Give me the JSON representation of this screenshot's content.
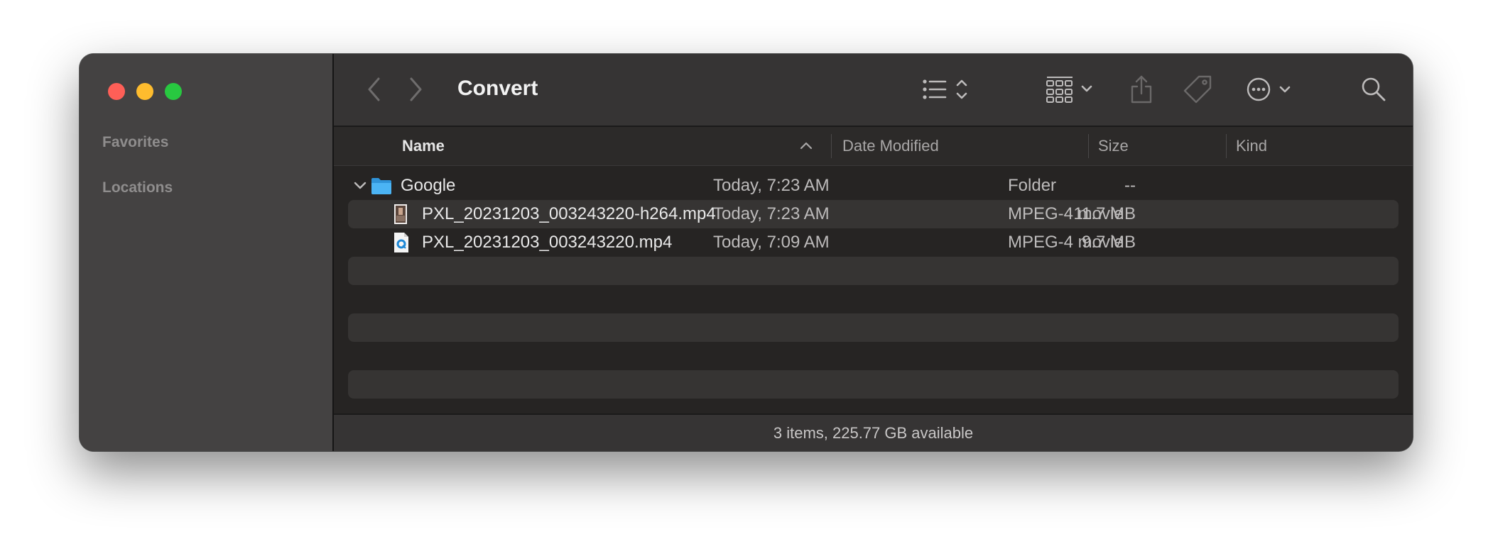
{
  "sidebar": {
    "sections": [
      "Favorites",
      "Locations"
    ]
  },
  "toolbar": {
    "title": "Convert"
  },
  "columns": {
    "name": "Name",
    "date": "Date Modified",
    "size": "Size",
    "kind": "Kind"
  },
  "files": [
    {
      "name": "Google",
      "date": "Today, 7:23 AM",
      "size": "--",
      "kind": "Folder",
      "icon": "folder-icon"
    },
    {
      "name": "PXL_20231203_003243220-h264.mp4",
      "date": "Today, 7:23 AM",
      "size": "11.7 MB",
      "kind": "MPEG-4 movie",
      "icon": "video-thumbnail-icon"
    },
    {
      "name": "PXL_20231203_003243220.mp4",
      "date": "Today, 7:09 AM",
      "size": "9.7 MB",
      "kind": "MPEG-4 movie",
      "icon": "quicktime-file-icon"
    }
  ],
  "status": {
    "text": "3 items, 225.77 GB available"
  },
  "colors": {
    "accent_folder": "#39a8f0",
    "traffic_red": "#fe5f57",
    "traffic_yellow": "#febc2e",
    "traffic_green": "#28c840"
  }
}
